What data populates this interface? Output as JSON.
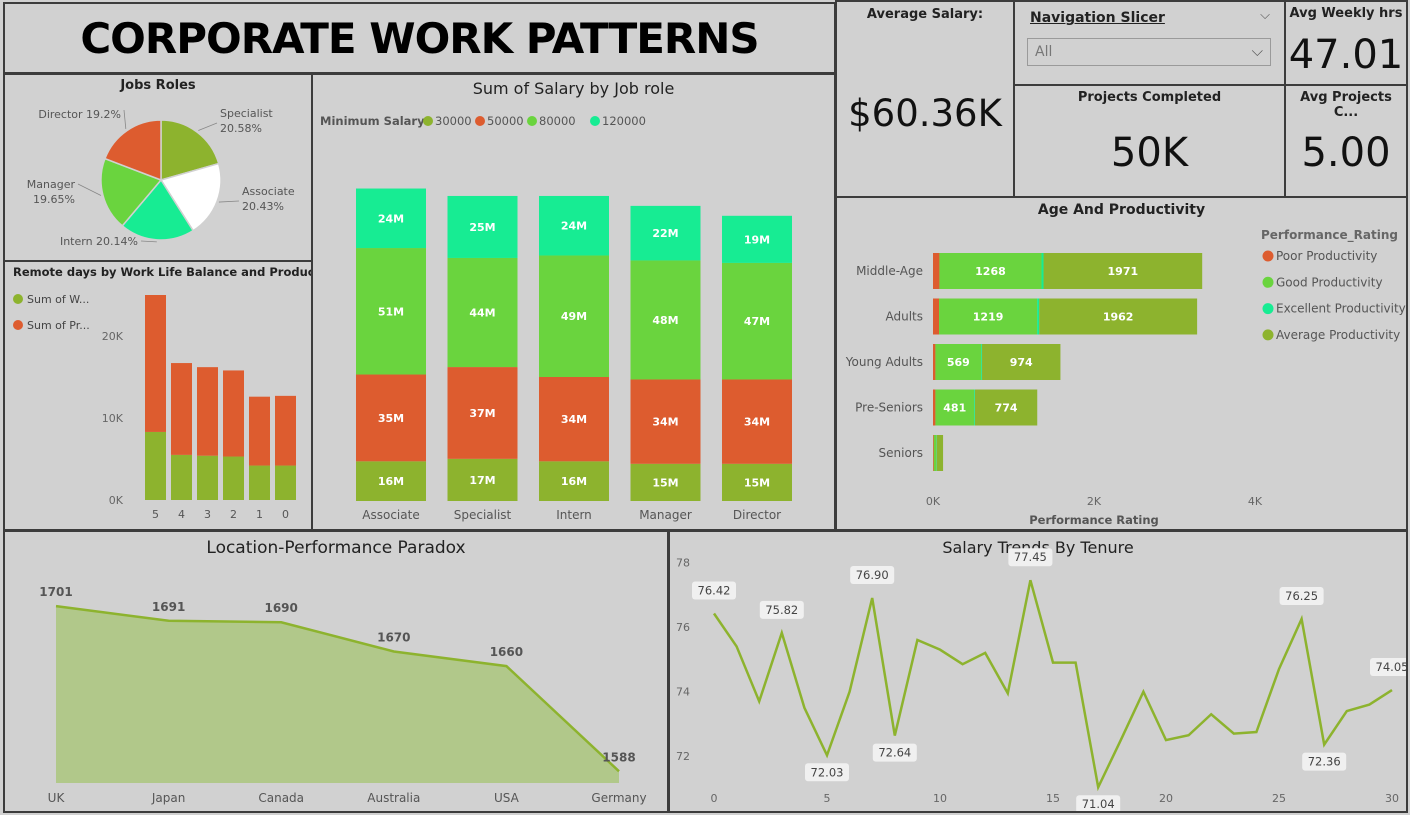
{
  "title": "CORPORATE WORK PATTERNS",
  "kpis": {
    "avg_salary_label": "Average Salary:",
    "avg_salary_value": "$60.36K",
    "avg_weekly_label": "Avg Weekly hrs",
    "avg_weekly_value": "47.01",
    "projects_label": "Projects Completed",
    "projects_value": "50K",
    "avg_projects_label": "Avg Projects C...",
    "avg_projects_value": "5.00"
  },
  "slicer": {
    "title": "Navigation Slicer",
    "selected": "All"
  },
  "colors": {
    "olive": "#8db32e",
    "orange": "#dd5c2f",
    "green": "#6ad43e",
    "teal": "#17ec93",
    "white": "#ffffff",
    "area_fill": "#b1c88a"
  },
  "chart_data": [
    {
      "id": "jobs_roles",
      "type": "pie",
      "title": "Jobs Roles",
      "slices": [
        {
          "label": "Specialist",
          "pct": "20.58%",
          "value": 20.58,
          "color": "#8db32e"
        },
        {
          "label": "Associate",
          "pct": "20.43%",
          "value": 20.43,
          "color": "#ffffff"
        },
        {
          "label": "Intern",
          "pct": "20.14%",
          "value": 20.14,
          "color": "#17ec93"
        },
        {
          "label": "Manager",
          "pct": "19.65%",
          "value": 19.65,
          "color": "#6ad43e"
        },
        {
          "label": "Director",
          "pct": "19.2%",
          "value": 19.2,
          "color": "#dd5c2f"
        }
      ]
    },
    {
      "id": "remote_days",
      "type": "bar",
      "title": "Remote days by Work Life Balance and Productivity",
      "legend": [
        "Sum of W...",
        "Sum of Pr..."
      ],
      "categories": [
        "5",
        "4",
        "3",
        "2",
        "1",
        "0"
      ],
      "series": [
        {
          "name": "Sum of W...",
          "color": "#8db32e",
          "values": [
            8300,
            5500,
            5400,
            5300,
            4200,
            4200
          ]
        },
        {
          "name": "Sum of Pr...",
          "color": "#dd5c2f",
          "values": [
            16700,
            11200,
            10800,
            10500,
            8400,
            8500
          ]
        }
      ],
      "y_ticks": [
        "0K",
        "10K",
        "20K"
      ],
      "ylim": [
        0,
        25000
      ]
    },
    {
      "id": "salary_by_role",
      "type": "bar",
      "title": "Sum of Salary by Job role",
      "legend_title": "Minimum Salary",
      "categories": [
        "Associate",
        "Specialist",
        "Intern",
        "Manager",
        "Director"
      ],
      "series": [
        {
          "name": "30000",
          "color": "#8db32e",
          "values": [
            16,
            17,
            16,
            15,
            15
          ],
          "labels": [
            "16M",
            "17M",
            "16M",
            "15M",
            "15M"
          ]
        },
        {
          "name": "50000",
          "color": "#dd5c2f",
          "values": [
            35,
            37,
            34,
            34,
            34
          ],
          "labels": [
            "35M",
            "37M",
            "34M",
            "34M",
            "34M"
          ]
        },
        {
          "name": "80000",
          "color": "#6ad43e",
          "values": [
            51,
            44,
            49,
            48,
            47
          ],
          "labels": [
            "51M",
            "44M",
            "49M",
            "48M",
            "47M"
          ]
        },
        {
          "name": "120000",
          "color": "#17ec93",
          "values": [
            24,
            25,
            24,
            22,
            19
          ],
          "labels": [
            "24M",
            "25M",
            "24M",
            "22M",
            "19M"
          ]
        }
      ],
      "ylim": [
        0,
        140
      ]
    },
    {
      "id": "age_productivity",
      "type": "bar",
      "title": "Age And Productivity",
      "xlabel": "Performance Rating",
      "legend_title": "Performance_Rating",
      "categories": [
        "Middle-Age",
        "Adults",
        "Young Adults",
        "Pre-Seniors",
        "Seniors"
      ],
      "series": [
        {
          "name": "Poor Productivity",
          "color": "#dd5c2f",
          "values": [
            80,
            75,
            30,
            30,
            10
          ],
          "labels": [
            "",
            "",
            "",
            "",
            ""
          ]
        },
        {
          "name": "Good Productivity",
          "color": "#6ad43e",
          "values": [
            1268,
            1219,
            569,
            481,
            30
          ],
          "labels": [
            "1268",
            "1219",
            "569",
            "481",
            ""
          ]
        },
        {
          "name": "Excellent Productivity",
          "color": "#17ec93",
          "values": [
            25,
            25,
            10,
            10,
            5
          ],
          "labels": [
            "",
            "",
            "",
            "",
            ""
          ]
        },
        {
          "name": "Average Productivity",
          "color": "#8db32e",
          "values": [
            1971,
            1962,
            974,
            774,
            80
          ],
          "labels": [
            "1971",
            "1962",
            "974",
            "774",
            ""
          ]
        }
      ],
      "x_ticks": [
        "0K",
        "2K",
        "4K"
      ],
      "xlim": [
        0,
        4000
      ]
    },
    {
      "id": "location_performance",
      "type": "area",
      "title": "Location-Performance Paradox",
      "categories": [
        "UK",
        "Japan",
        "Canada",
        "Australia",
        "USA",
        "Germany"
      ],
      "values": [
        1701,
        1691,
        1690,
        1670,
        1660,
        1588
      ],
      "ylim": [
        1580,
        1710
      ]
    },
    {
      "id": "salary_tenure",
      "type": "line",
      "title": "Salary Trends By Tenure",
      "x": [
        0,
        1,
        2,
        3,
        4,
        5,
        6,
        7,
        8,
        9,
        10,
        11,
        12,
        13,
        14,
        15,
        16,
        17,
        18,
        19,
        20,
        21,
        22,
        23,
        24,
        25,
        26,
        27,
        28,
        29,
        30
      ],
      "y": [
        76.42,
        75.4,
        73.7,
        75.82,
        73.5,
        72.03,
        74.0,
        76.9,
        72.64,
        75.6,
        75.3,
        74.85,
        75.2,
        73.95,
        77.45,
        74.9,
        74.9,
        71.04,
        72.5,
        74.0,
        72.5,
        72.65,
        73.3,
        72.7,
        72.75,
        74.7,
        76.25,
        72.36,
        73.4,
        73.6,
        74.05
      ],
      "labelled": {
        "0": "76.42",
        "3": "75.82",
        "5": "72.03",
        "7": "76.90",
        "8": "72.64",
        "14": "77.45",
        "17": "71.04",
        "26": "76.25",
        "27": "72.36",
        "30": "74.05"
      },
      "x_ticks": [
        "0",
        "5",
        "10",
        "15",
        "20",
        "25",
        "30"
      ],
      "y_ticks": [
        "72",
        "74",
        "76",
        "78"
      ],
      "ylim": [
        70.8,
        78.2
      ]
    }
  ]
}
